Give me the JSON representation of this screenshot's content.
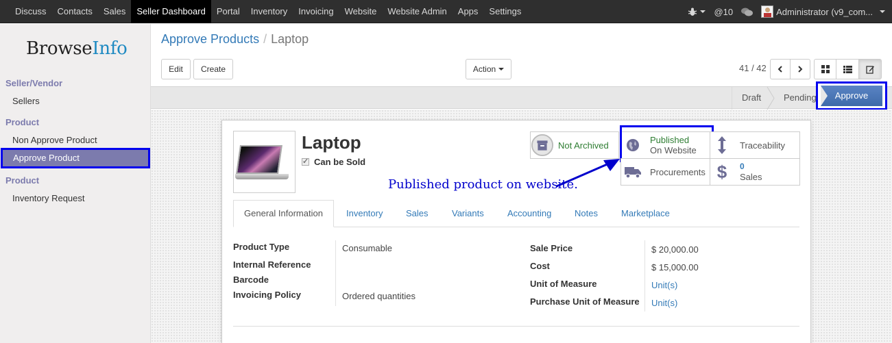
{
  "topbar": {
    "menu": [
      "Discuss",
      "Contacts",
      "Sales",
      "Seller Dashboard",
      "Portal",
      "Inventory",
      "Invoicing",
      "Website",
      "Website Admin",
      "Apps",
      "Settings"
    ],
    "active": "Seller Dashboard",
    "messages_count": "@10",
    "user": "Administrator (v9_com..."
  },
  "sidebar": {
    "logo_part1": "Browse",
    "logo_part2": "Info",
    "section1": "Seller/Vendor",
    "sellers": "Sellers",
    "section2": "Product",
    "non_approve": "Non Approve Product",
    "approve": "Approve Product",
    "section3": "Product",
    "inventory_request": "Inventory Request"
  },
  "header": {
    "breadcrumb_link": "Approve Products",
    "breadcrumb_sep": "/",
    "breadcrumb_current": "Laptop",
    "edit": "Edit",
    "create": "Create",
    "action": "Action",
    "pager": "41 / 42"
  },
  "statusbar": {
    "stages": [
      "Draft",
      "Pending",
      "Approve"
    ],
    "current": "Approve"
  },
  "product": {
    "name": "Laptop",
    "can_be_sold": "Can be Sold"
  },
  "smart_buttons": {
    "archive": "Not Archived",
    "published_line1": "Published",
    "published_line2": "On Website",
    "traceability": "Traceability",
    "procurements": "Procurements",
    "sales_count": "0",
    "sales_label": "Sales"
  },
  "annotation": "Published product on website.",
  "tabs": [
    "General Information",
    "Inventory",
    "Sales",
    "Variants",
    "Accounting",
    "Notes",
    "Marketplace"
  ],
  "fields_left": {
    "product_type_label": "Product Type",
    "product_type_value": "Consumable",
    "internal_ref_label": "Internal Reference",
    "barcode_label": "Barcode",
    "invoicing_label": "Invoicing Policy",
    "invoicing_value": "Ordered quantities"
  },
  "fields_right": {
    "sale_price_label": "Sale Price",
    "sale_price_value": "$ 20,000.00",
    "cost_label": "Cost",
    "cost_value": "$ 15,000.00",
    "uom_label": "Unit of Measure",
    "uom_value": "Unit(s)",
    "purchase_uom_label": "Purchase Unit of Measure",
    "purchase_uom_value": "Unit(s)"
  },
  "colors": {
    "topbar": "#2f2f2f",
    "sidebar_accent": "#7c7bad",
    "link": "#337ab7",
    "highlight_frame": "#0000ee",
    "published_green": "#2e7d32"
  }
}
